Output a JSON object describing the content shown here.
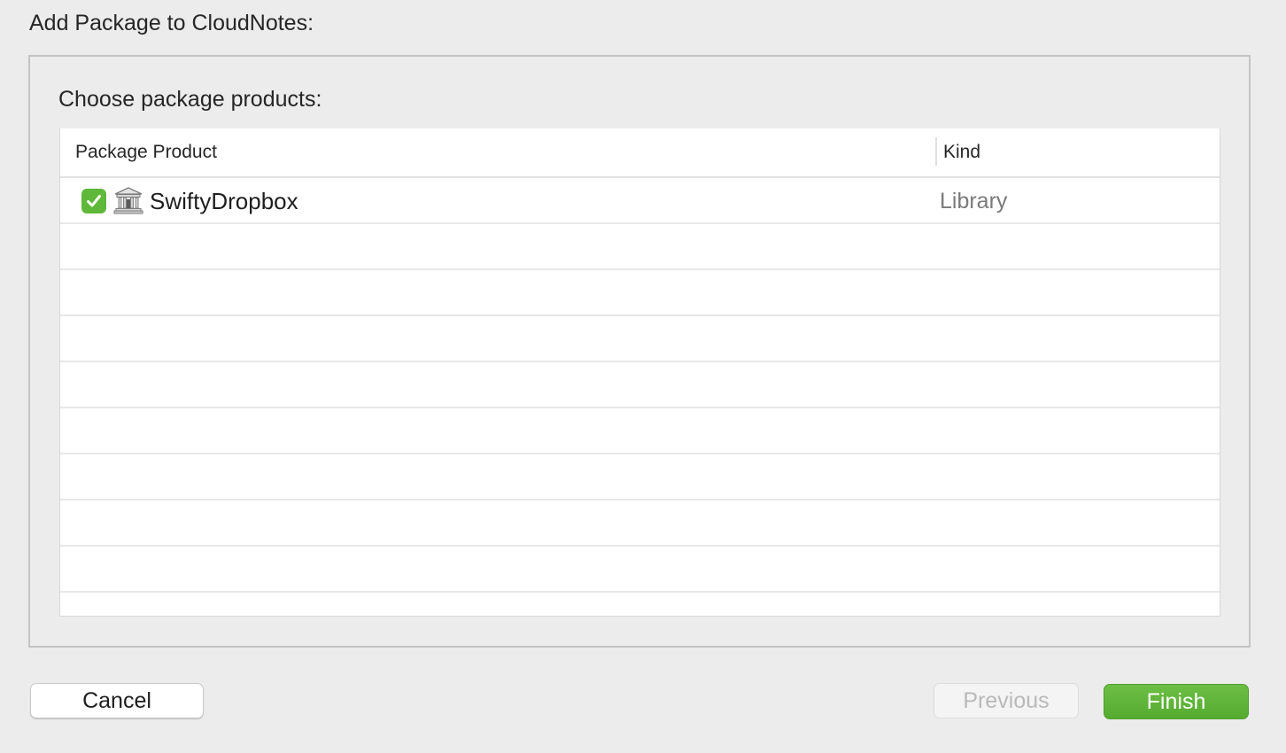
{
  "sheet": {
    "title": "Add Package to CloudNotes:"
  },
  "panel": {
    "heading": "Choose package products:"
  },
  "table": {
    "columns": [
      "Package Product",
      "Kind"
    ],
    "rows": [
      {
        "checked": true,
        "icon": "library-icon",
        "product": "SwiftyDropbox",
        "kind": "Library"
      }
    ]
  },
  "buttons": {
    "cancel": "Cancel",
    "previous": "Previous",
    "finish": "Finish"
  },
  "colors": {
    "accent_green": "#5fb83a",
    "finish_green": "#5db536",
    "disabled_text": "#b9b9b9"
  }
}
